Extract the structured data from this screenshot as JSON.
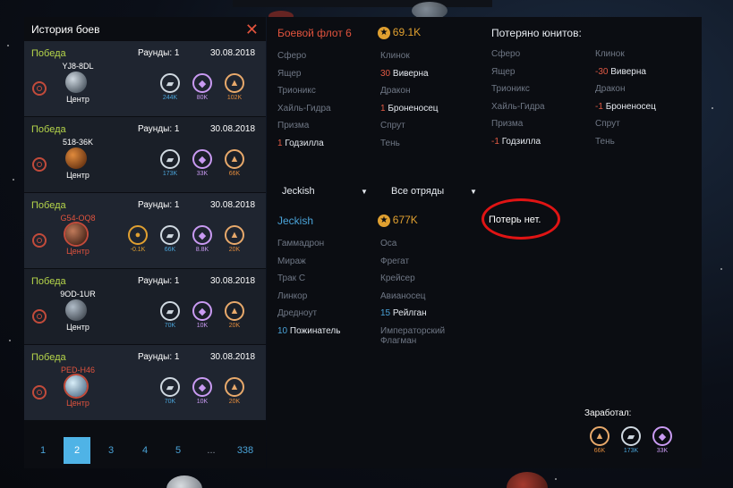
{
  "history": {
    "title": "История боев",
    "battles": [
      {
        "result": "Победа",
        "rounds": "Раунды: 1",
        "date": "30.08.2018",
        "system": "YJ8-8DL",
        "planet": "Центр",
        "hostile": false,
        "resources": [
          {
            "icon": "ingot-icon",
            "color": "blue",
            "value": "244K"
          },
          {
            "icon": "crystal-icon",
            "color": "purple",
            "value": "80K"
          },
          {
            "icon": "fuel-icon",
            "color": "orange",
            "value": "102K"
          }
        ]
      },
      {
        "result": "Победа",
        "rounds": "Раунды: 1",
        "date": "30.08.2018",
        "system": "518-36K",
        "planet": "Центр",
        "hostile": false,
        "resources": [
          {
            "icon": "ingot-icon",
            "color": "blue",
            "value": "173K"
          },
          {
            "icon": "crystal-icon",
            "color": "purple",
            "value": "33K"
          },
          {
            "icon": "fuel-icon",
            "color": "orange",
            "value": "66K"
          }
        ]
      },
      {
        "result": "Победа",
        "rounds": "Раунды: 1",
        "date": "30.08.2018",
        "system": "G54-OQ8",
        "planet": "Центр",
        "hostile": true,
        "resources": [
          {
            "icon": "population-icon",
            "color": "gold",
            "value": "-0.1K"
          },
          {
            "icon": "ingot-icon",
            "color": "blue",
            "value": "66K"
          },
          {
            "icon": "crystal-icon",
            "color": "purple",
            "value": "8.8K"
          },
          {
            "icon": "fuel-icon",
            "color": "orange",
            "value": "20K"
          }
        ]
      },
      {
        "result": "Победа",
        "rounds": "Раунды: 1",
        "date": "30.08.2018",
        "system": "9OD-1UR",
        "planet": "Центр",
        "hostile": false,
        "resources": [
          {
            "icon": "ingot-icon",
            "color": "blue",
            "value": "70K"
          },
          {
            "icon": "crystal-icon",
            "color": "purple",
            "value": "10K"
          },
          {
            "icon": "fuel-icon",
            "color": "orange",
            "value": "20K"
          }
        ]
      },
      {
        "result": "Победа",
        "rounds": "Раунды: 1",
        "date": "30.08.2018",
        "system": "PED-H46",
        "planet": "Центр",
        "hostile": true,
        "resources": [
          {
            "icon": "ingot-icon",
            "color": "blue",
            "value": "70K"
          },
          {
            "icon": "crystal-icon",
            "color": "purple",
            "value": "10K"
          },
          {
            "icon": "fuel-icon",
            "color": "orange",
            "value": "20K"
          }
        ]
      }
    ],
    "pages": [
      "1",
      "2",
      "3",
      "4",
      "5",
      "...",
      "338"
    ],
    "active_page": "2"
  },
  "attacker": {
    "fleet_name": "Боевой флот 6",
    "power": "69.1K",
    "lost_title": "Потеряно юнитов:",
    "units_col1": [
      {
        "count": "",
        "name": "Сферо"
      },
      {
        "count": "",
        "name": "Ящер"
      },
      {
        "count": "",
        "name": "Трионикс"
      },
      {
        "count": "",
        "name": "Хайль-Гидра"
      },
      {
        "count": "",
        "name": "Призма"
      },
      {
        "count": "1",
        "name": "Годзилла"
      }
    ],
    "units_col2": [
      {
        "count": "",
        "name": "Клинок"
      },
      {
        "count": "30",
        "name": "Виверна"
      },
      {
        "count": "",
        "name": "Дракон"
      },
      {
        "count": "1",
        "name": "Броненосец"
      },
      {
        "count": "",
        "name": "Спрут"
      },
      {
        "count": "",
        "name": "Тень"
      }
    ],
    "lost_col1": [
      {
        "count": "",
        "name": "Сферо"
      },
      {
        "count": "",
        "name": "Ящер"
      },
      {
        "count": "",
        "name": "Трионикс"
      },
      {
        "count": "",
        "name": "Хайль-Гидра"
      },
      {
        "count": "",
        "name": "Призма"
      },
      {
        "count": "-1",
        "name": "Годзилла"
      }
    ],
    "lost_col2": [
      {
        "count": "",
        "name": "Клинок"
      },
      {
        "count": "-30",
        "name": "Виверна"
      },
      {
        "count": "",
        "name": "Дракон"
      },
      {
        "count": "-1",
        "name": "Броненосец"
      },
      {
        "count": "",
        "name": "Спрут"
      },
      {
        "count": "",
        "name": "Тень"
      }
    ]
  },
  "defender": {
    "player_select": "Jeckish",
    "squad_select": "Все отряды",
    "name": "Jeckish",
    "power": "677K",
    "no_losses": "Потерь нет.",
    "units_col1": [
      {
        "count": "",
        "name": "Гаммадрон"
      },
      {
        "count": "",
        "name": "Мираж"
      },
      {
        "count": "",
        "name": "Трак С"
      },
      {
        "count": "",
        "name": "Линкор"
      },
      {
        "count": "",
        "name": "Дредноут"
      },
      {
        "count": "10",
        "name": "Пожинатель"
      }
    ],
    "units_col2": [
      {
        "count": "",
        "name": "Оса"
      },
      {
        "count": "",
        "name": "Фрегат"
      },
      {
        "count": "",
        "name": "Крейсер"
      },
      {
        "count": "",
        "name": "Авианосец"
      },
      {
        "count": "15",
        "name": "Рейлган"
      },
      {
        "count": "",
        "name": "Императорский Флагман"
      }
    ]
  },
  "earned": {
    "label": "Заработал:",
    "resources": [
      {
        "icon": "fuel-icon",
        "color": "orange",
        "value": "66K"
      },
      {
        "icon": "ingot-icon",
        "color": "blue",
        "value": "173K"
      },
      {
        "icon": "crystal-icon",
        "color": "purple",
        "value": "33K"
      }
    ]
  }
}
